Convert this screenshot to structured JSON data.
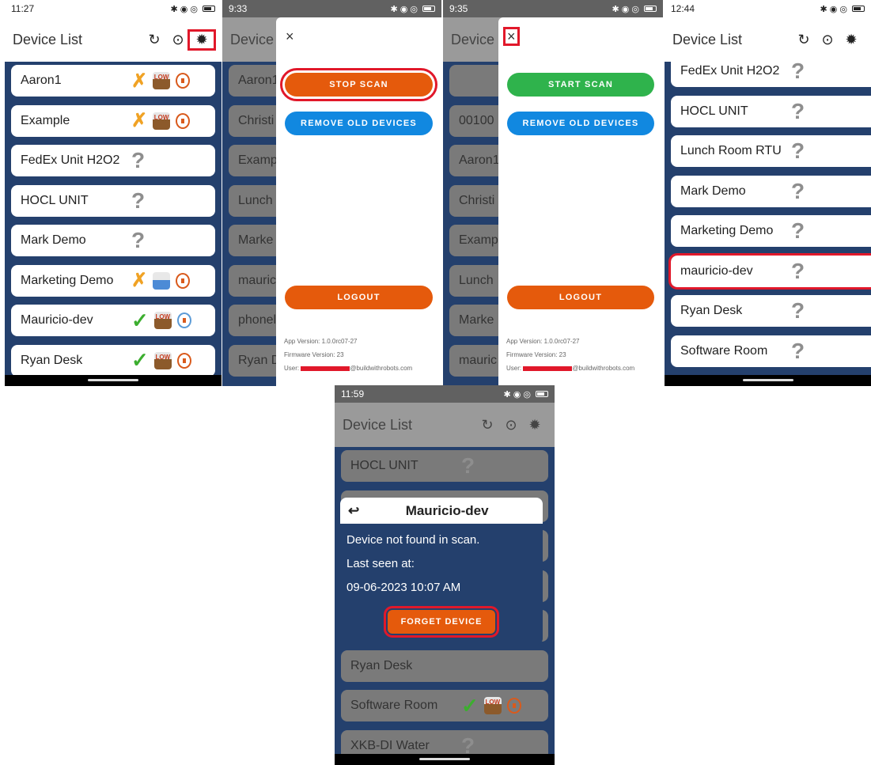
{
  "s1": {
    "time": "11:27",
    "title": "Device List",
    "rows": [
      {
        "name": "Aaron1",
        "st": "x",
        "bat": "low",
        "lock": "o"
      },
      {
        "name": "Example",
        "st": "x",
        "bat": "low",
        "lock": "o"
      },
      {
        "name": "FedEx Unit H2O2",
        "st": "q"
      },
      {
        "name": "HOCL UNIT",
        "st": "q"
      },
      {
        "name": "Mark Demo",
        "st": "q"
      },
      {
        "name": "Marketing Demo",
        "st": "x",
        "bat": "blue",
        "lock": "o"
      },
      {
        "name": "Mauricio-dev",
        "st": "c",
        "bat": "low",
        "lock": "b"
      },
      {
        "name": "Ryan Desk",
        "st": "c",
        "bat": "low",
        "lock": "o"
      }
    ]
  },
  "s2": {
    "time": "9:33",
    "title": "Device",
    "rows": [
      "Aaron1",
      "Christi",
      "Examp",
      "Lunch",
      "Marke",
      "mauric",
      "phonel",
      "Ryan D"
    ],
    "close": "×",
    "stop": "STOP SCAN",
    "remove": "REMOVE OLD DEVICES",
    "logout": "LOGOUT",
    "app": "App Version: 1.0.0rc07-27",
    "fw": "Firmware Version: 23",
    "user_pre": "User:",
    "user_post": "@buildwithrobots.com"
  },
  "s3": {
    "time": "9:35",
    "title": "Device",
    "rows": [
      "",
      "00100",
      "Aaron1",
      "Christi",
      "Examp",
      "Lunch",
      "Marke",
      "mauric"
    ],
    "close": "×",
    "start": "START SCAN",
    "remove": "REMOVE OLD DEVICES",
    "logout": "LOGOUT",
    "app": "App Version: 1.0.0rc07-27",
    "fw": "Firmware Version: 23",
    "user_pre": "User:",
    "user_post": "@buildwithrobots.com"
  },
  "s4": {
    "time": "12:44",
    "title": "Device List",
    "rows": [
      "FedEx Unit H2O2",
      "HOCL UNIT",
      "Lunch Room RTU",
      "Mark Demo",
      "Marketing Demo",
      "mauricio-dev",
      "Ryan Desk",
      "Software Room"
    ]
  },
  "s5": {
    "time": "11:59",
    "title": "Device List",
    "rows": [
      "HOCL UNIT",
      "",
      "",
      "",
      "",
      "Ryan Desk",
      "Software Room",
      "XKB-DI Water"
    ],
    "modal": {
      "title": "Mauricio-dev",
      "l1": "Device not found in scan.",
      "l2": "Last seen at:",
      "l3": "09-06-2023 10:07 AM",
      "btn": "FORGET DEVICE"
    }
  },
  "icons": {
    "refresh": "refresh-icon",
    "locate": "locate-icon",
    "settings": "gear-icon"
  },
  "colors": {
    "navy": "#24406d",
    "orange": "#e55a0c",
    "blue": "#1188e0",
    "green": "#2fb34c",
    "highlight": "#e1182a"
  }
}
